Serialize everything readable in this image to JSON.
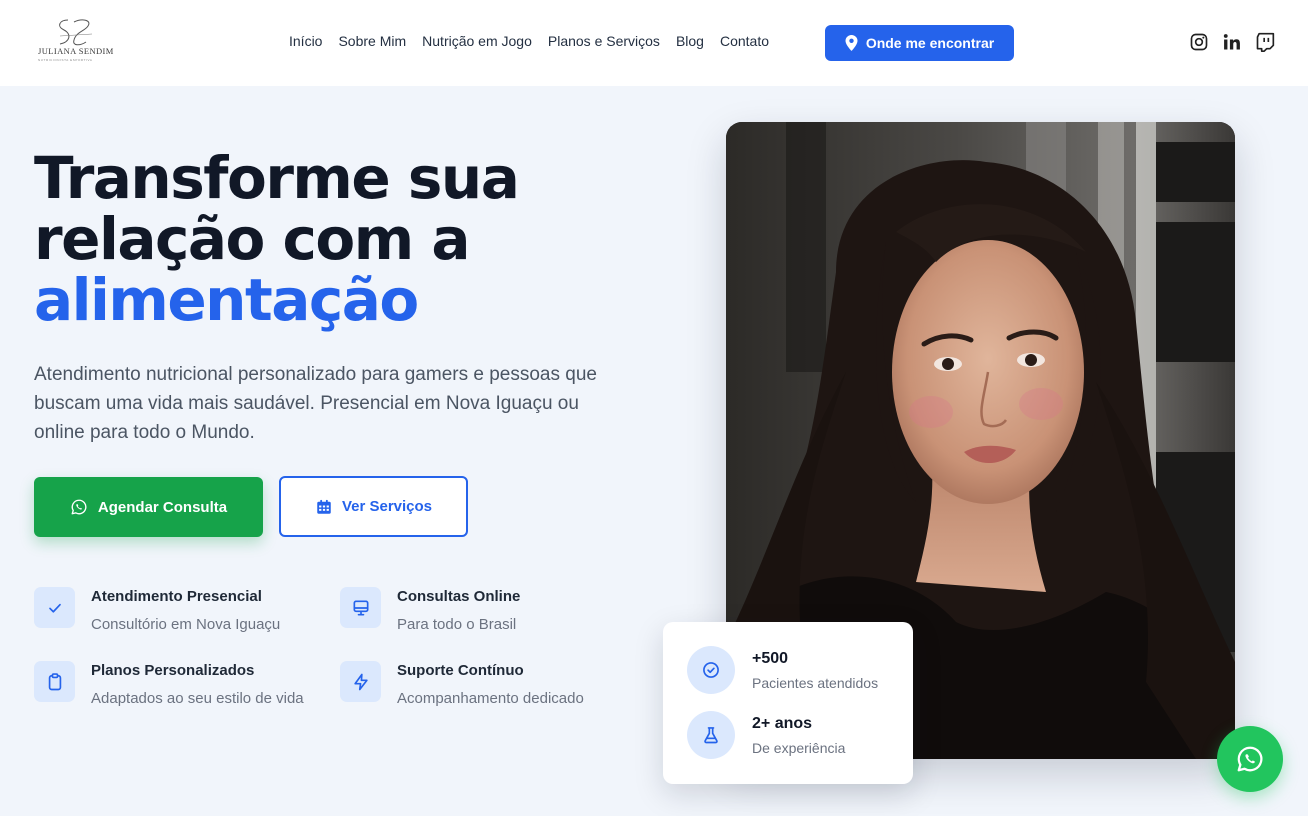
{
  "brand": {
    "name": "JULIANA SENDIM",
    "tagline": "NUTRICIONISTA ESPORTIVA"
  },
  "nav": {
    "items": [
      "Início",
      "Sobre Mim",
      "Nutrição em Jogo",
      "Planos e Serviços",
      "Blog",
      "Contato"
    ],
    "cta_label": "Onde me encontrar",
    "social_icons": [
      "instagram-icon",
      "linkedin-icon",
      "twitch-icon"
    ]
  },
  "hero": {
    "headline": {
      "line1": "Transforme sua",
      "line2": "relação com a",
      "line3": "alimentação"
    },
    "lead": "Atendimento nutricional personalizado para gamers e pessoas que buscam uma vida mais saudável. Presencial em Nova Iguaçu ou online para todo o Mundo.",
    "primary_button": "Agendar Consulta",
    "secondary_button": "Ver Serviços"
  },
  "features": [
    {
      "title": "Atendimento Presencial",
      "desc": "Consultório em Nova Iguaçu",
      "icon": "check-icon"
    },
    {
      "title": "Consultas Online",
      "desc": "Para todo o Brasil",
      "icon": "monitor-icon"
    },
    {
      "title": "Planos Personalizados",
      "desc": "Adaptados ao seu estilo de vida",
      "icon": "clipboard-icon"
    },
    {
      "title": "Suporte Contínuo",
      "desc": "Acompanhamento dedicado",
      "icon": "bolt-icon"
    }
  ],
  "stats": [
    {
      "value": "+500",
      "label": "Pacientes atendidos",
      "icon": "check-circle-icon"
    },
    {
      "value": "2+ anos",
      "label": "De experiência",
      "icon": "flask-icon"
    }
  ],
  "colors": {
    "accent": "#2563eb",
    "whatsapp": "#16a34a",
    "background": "#f1f5fb",
    "icon_bg": "#dbe8fd"
  }
}
